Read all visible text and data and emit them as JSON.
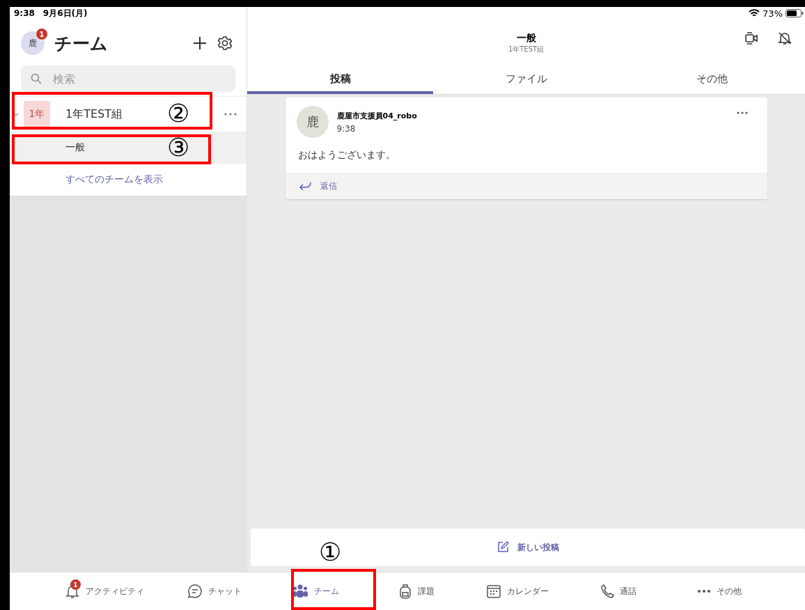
{
  "status_bar": {
    "time": "9:38",
    "date": "9月6日(月)",
    "battery": "73%"
  },
  "sidebar": {
    "avatar": "鹿",
    "avatar_badge": "1",
    "title": "チーム",
    "search": {
      "placeholder": "検索"
    },
    "teams": [
      {
        "badge": "1年",
        "name": "1年TEST組",
        "expanded": true,
        "channels": [
          {
            "name": "一般",
            "selected": true
          }
        ]
      }
    ],
    "show_all": "すべてのチームを表示"
  },
  "channel_header": {
    "title": "一般",
    "subtitle": "1年TEST組"
  },
  "tabs": [
    {
      "label": "投稿",
      "selected": true
    },
    {
      "label": "ファイル",
      "selected": false
    },
    {
      "label": "その他",
      "selected": false
    }
  ],
  "posts": [
    {
      "avatar": "鹿",
      "author": "鹿屋市支援員04_robo",
      "time": "9:38",
      "body": "おはようございます。",
      "reply": "返信"
    }
  ],
  "new_post": "新しい投稿",
  "nav": [
    {
      "kind": "bell",
      "label": "アクティビティ",
      "badge": "1",
      "selected": false
    },
    {
      "kind": "chat",
      "label": "チャット",
      "selected": false
    },
    {
      "kind": "teams",
      "label": "チーム",
      "selected": true
    },
    {
      "kind": "backpack",
      "label": "課題",
      "selected": false
    },
    {
      "kind": "calendar",
      "label": "カレンダー",
      "selected": false
    },
    {
      "kind": "phone",
      "label": "通話",
      "selected": false
    },
    {
      "kind": "more",
      "label": "その他",
      "selected": false
    }
  ],
  "annotations": [
    {
      "label": "①"
    },
    {
      "label": "②"
    },
    {
      "label": "③"
    }
  ]
}
